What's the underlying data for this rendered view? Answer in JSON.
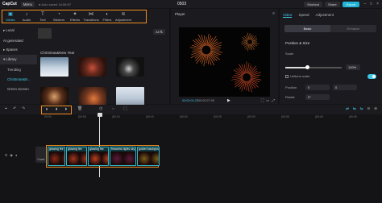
{
  "titlebar": {
    "logo": "CapCut",
    "menu_label": "Menu",
    "autosave": "● Auto saved 16:58:57",
    "project_title": "0503",
    "shortcut_label": "Shortcut",
    "share_label": "Share",
    "export_label": "Export"
  },
  "media_tabs": [
    {
      "label": "Media",
      "icon": "media-icon",
      "glyph": "▣"
    },
    {
      "label": "Audio",
      "icon": "audio-icon",
      "glyph": "♪"
    },
    {
      "label": "Text",
      "icon": "text-icon",
      "glyph": "T"
    },
    {
      "label": "Stickers",
      "icon": "sticker-icon",
      "glyph": "◔"
    },
    {
      "label": "Effects",
      "icon": "effects-icon",
      "glyph": "✦"
    },
    {
      "label": "Transitions",
      "icon": "transition-icon",
      "glyph": "⋈"
    },
    {
      "label": "Filters",
      "icon": "filter-icon",
      "glyph": "◐"
    },
    {
      "label": "Adjustment",
      "icon": "adjust-icon",
      "glyph": "≋"
    }
  ],
  "sidebar": {
    "items": [
      {
        "label": "▸ Local"
      },
      {
        "label": "AI generated"
      },
      {
        "label": "▸ Spaces"
      },
      {
        "label": "▾ Library"
      },
      {
        "label": "Trending"
      },
      {
        "label": "Christmas&N..."
      },
      {
        "label": "Green Screen"
      }
    ]
  },
  "media": {
    "all_label": "All ⇅",
    "section_label": "Christmas&New Year"
  },
  "player": {
    "title": "Player",
    "current_time": "00:00:01:23",
    "total_time": "00:00:27:09"
  },
  "props": {
    "tabs": [
      "Video",
      "Speed",
      "Adjustment"
    ],
    "subtabs": [
      "Basic",
      "Enhance"
    ],
    "section": "Position & Size",
    "scale_label": "Scale",
    "scale_value": "100%",
    "scale_fraction": 0.38,
    "uniform_label": "Uniform scale",
    "position_label": "Position",
    "pos_x": "0",
    "pos_y": "0",
    "rotate_label": "Rotate",
    "rotate_value": "0°"
  },
  "timeline": {
    "ruler": [
      "00:00",
      "|00:05",
      "|00:10",
      "|00:15",
      "|00:20",
      "|00:25",
      "|00:30",
      "|00:35",
      "|00:40",
      "|00:45"
    ],
    "cover_label": "Cover",
    "clips": [
      {
        "label": "glowing fire"
      },
      {
        "label": "glowing fire"
      },
      {
        "label": "glowing fire"
      },
      {
        "label": "fireworks lights sky"
      },
      {
        "label": "golden background"
      }
    ]
  }
}
